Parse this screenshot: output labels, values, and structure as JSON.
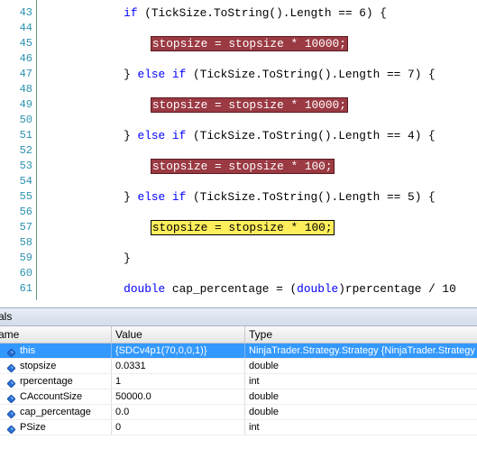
{
  "editor": {
    "lines": [
      {
        "num": "43",
        "tokens": [
          {
            "t": "            "
          },
          {
            "t": "if",
            "c": "kw"
          },
          {
            "t": " (TickSize.ToString().Length == 6) {"
          }
        ]
      },
      {
        "num": "44",
        "tokens": []
      },
      {
        "num": "45",
        "tokens": [
          {
            "t": "                "
          },
          {
            "t": "stopsize = stopsize * 10000;",
            "c": "bp"
          }
        ]
      },
      {
        "num": "46",
        "tokens": []
      },
      {
        "num": "47",
        "tokens": [
          {
            "t": "            } "
          },
          {
            "t": "else",
            "c": "kw"
          },
          {
            "t": " "
          },
          {
            "t": "if",
            "c": "kw"
          },
          {
            "t": " (TickSize.ToString().Length == 7) {"
          }
        ]
      },
      {
        "num": "48",
        "tokens": []
      },
      {
        "num": "49",
        "tokens": [
          {
            "t": "                "
          },
          {
            "t": "stopsize = stopsize * 10000;",
            "c": "bp"
          }
        ]
      },
      {
        "num": "50",
        "tokens": []
      },
      {
        "num": "51",
        "tokens": [
          {
            "t": "            } "
          },
          {
            "t": "else",
            "c": "kw"
          },
          {
            "t": " "
          },
          {
            "t": "if",
            "c": "kw"
          },
          {
            "t": " (TickSize.ToString().Length == 4) {"
          }
        ]
      },
      {
        "num": "52",
        "tokens": []
      },
      {
        "num": "53",
        "tokens": [
          {
            "t": "                "
          },
          {
            "t": "stopsize = stopsize * 100;",
            "c": "bp"
          }
        ]
      },
      {
        "num": "54",
        "tokens": []
      },
      {
        "num": "55",
        "tokens": [
          {
            "t": "            } "
          },
          {
            "t": "else",
            "c": "kw"
          },
          {
            "t": " "
          },
          {
            "t": "if",
            "c": "kw"
          },
          {
            "t": " (TickSize.ToString().Length == 5) {"
          }
        ]
      },
      {
        "num": "56",
        "tokens": []
      },
      {
        "num": "57",
        "tokens": [
          {
            "t": "                "
          },
          {
            "t": "stopsize = stopsize * 100;",
            "c": "cur"
          }
        ]
      },
      {
        "num": "58",
        "tokens": []
      },
      {
        "num": "59",
        "tokens": [
          {
            "t": "            }"
          }
        ]
      },
      {
        "num": "60",
        "tokens": []
      },
      {
        "num": "61",
        "tokens": [
          {
            "t": "            "
          },
          {
            "t": "double",
            "c": "kw"
          },
          {
            "t": " cap_percentage = ("
          },
          {
            "t": "double",
            "c": "kw"
          },
          {
            "t": ")rpercentage / 10"
          }
        ]
      }
    ]
  },
  "locals": {
    "title": "als",
    "columns": [
      "ame",
      "Value",
      "Type"
    ],
    "rows": [
      {
        "name": "this",
        "value": "{SDCv4p1(70,0,0,1)}",
        "type": "NinjaTrader.Strategy.Strategy {NinjaTrader.Strategy",
        "selected": true
      },
      {
        "name": "stopsize",
        "value": "0.0331",
        "type": "double",
        "selected": false
      },
      {
        "name": "rpercentage",
        "value": "1",
        "type": "int",
        "selected": false
      },
      {
        "name": "CAccountSize",
        "value": "50000.0",
        "type": "double",
        "selected": false
      },
      {
        "name": "cap_percentage",
        "value": "0.0",
        "type": "double",
        "selected": false
      },
      {
        "name": "PSize",
        "value": "0",
        "type": "int",
        "selected": false
      }
    ]
  },
  "colors": {
    "keyword": "#0000ff",
    "line_number": "#2b91af",
    "breakpoint_bg": "#9b3a43",
    "current_statement_bg": "#ffee5c",
    "selection": "#3399ff",
    "variable_icon": "#2a6fd6"
  },
  "icons": {
    "variable": "variable-icon"
  }
}
